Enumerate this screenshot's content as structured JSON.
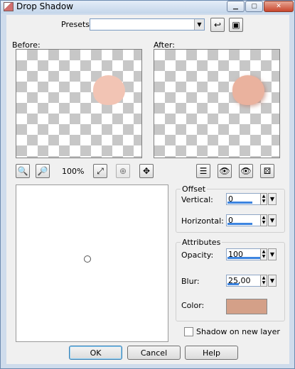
{
  "window": {
    "title": "Drop Shadow"
  },
  "presets": {
    "label": "Presets:",
    "value": ""
  },
  "previews": {
    "before_label": "Before:",
    "after_label": "After:"
  },
  "zoom": {
    "level": "100%"
  },
  "offset": {
    "group_label": "Offset",
    "vertical_label": "Vertical:",
    "vertical_value": "0",
    "vertical_fill": 0.75,
    "horizontal_label": "Horizontal:",
    "horizontal_value": "0",
    "horizontal_fill": 0.75
  },
  "attributes": {
    "group_label": "Attributes",
    "opacity_label": "Opacity:",
    "opacity_value": "100",
    "opacity_fill": 1.0,
    "blur_label": "Blur:",
    "blur_value": "25,00",
    "blur_fill": 0.35,
    "color_label": "Color:",
    "color_value": "#d4a088"
  },
  "shadow_on_new_layer": {
    "label": "Shadow on new layer",
    "checked": false
  },
  "buttons": {
    "ok": "OK",
    "cancel": "Cancel",
    "help": "Help"
  }
}
